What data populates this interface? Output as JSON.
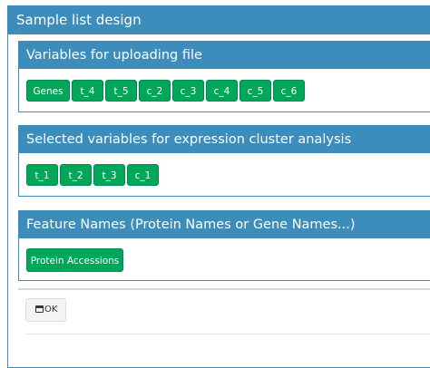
{
  "outer_panel": {
    "title": "Sample list design"
  },
  "upload_panel": {
    "title": "Variables for uploading file",
    "items": [
      "Genes",
      "t_4",
      "t_5",
      "c_2",
      "c_3",
      "c_4",
      "c_5",
      "c_6"
    ]
  },
  "cluster_panel": {
    "title": "Selected variables for expression cluster analysis",
    "items": [
      "t_1",
      "t_2",
      "t_3",
      "c_1"
    ]
  },
  "feature_panel": {
    "title": "Feature Names (Protein Names or Gene Names...)",
    "items": [
      "Protein Accessions"
    ]
  },
  "footer": {
    "ok_label": "OK",
    "ok_icon": "calendar-icon"
  },
  "colors": {
    "header_blue": "#3c8dbc",
    "chip_green": "#00a65a",
    "button_gray": "#f4f4f4"
  }
}
